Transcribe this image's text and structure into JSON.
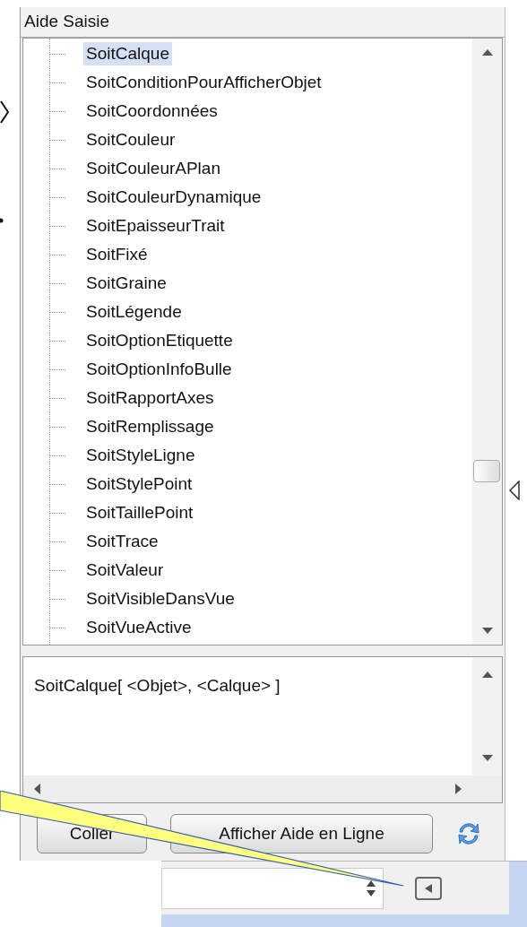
{
  "panel": {
    "title": "Aide Saisie"
  },
  "commands": [
    {
      "label": "SoitCalque",
      "selected": true
    },
    {
      "label": "SoitConditionPourAfficherObjet",
      "selected": false
    },
    {
      "label": "SoitCoordonnées",
      "selected": false
    },
    {
      "label": "SoitCouleur",
      "selected": false
    },
    {
      "label": "SoitCouleurAPlan",
      "selected": false
    },
    {
      "label": "SoitCouleurDynamique",
      "selected": false
    },
    {
      "label": "SoitEpaisseurTrait",
      "selected": false
    },
    {
      "label": "SoitFixé",
      "selected": false
    },
    {
      "label": "SoitGraine",
      "selected": false
    },
    {
      "label": "SoitLégende",
      "selected": false
    },
    {
      "label": "SoitOptionEtiquette",
      "selected": false
    },
    {
      "label": "SoitOptionInfoBulle",
      "selected": false
    },
    {
      "label": "SoitRapportAxes",
      "selected": false
    },
    {
      "label": "SoitRemplissage",
      "selected": false
    },
    {
      "label": "SoitStyleLigne",
      "selected": false
    },
    {
      "label": "SoitStylePoint",
      "selected": false
    },
    {
      "label": "SoitTaillePoint",
      "selected": false
    },
    {
      "label": "SoitTrace",
      "selected": false
    },
    {
      "label": "SoitValeur",
      "selected": false
    },
    {
      "label": "SoitVisibleDansVue",
      "selected": false
    },
    {
      "label": "SoitVueActive",
      "selected": false
    }
  ],
  "syntax": "SoitCalque[ <Objet>, <Calque> ]",
  "buttons": [
    {
      "label": "Coller"
    },
    {
      "label": "Afficher Aide en Ligne"
    }
  ]
}
